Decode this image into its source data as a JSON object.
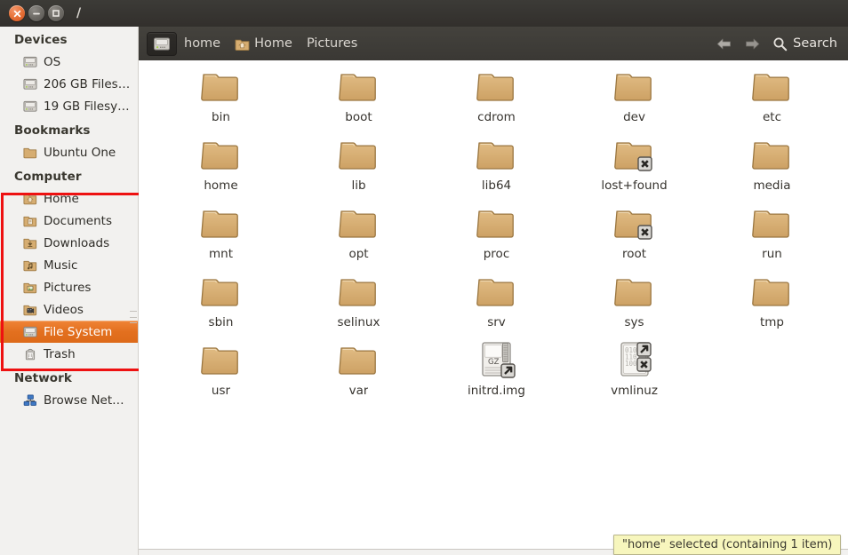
{
  "window": {
    "title": "/",
    "buttons": {
      "close": "close-button",
      "minimize": "minimize-button",
      "maximize": "maximize-button"
    }
  },
  "toolbar": {
    "location_icon": "drive-icon",
    "crumbs": [
      {
        "label": "home",
        "icon": "drive-icon"
      },
      {
        "label": "Home",
        "icon": "home-folder-icon"
      },
      {
        "label": "Pictures",
        "icon": ""
      }
    ],
    "back_label": "Back",
    "forward_label": "Forward",
    "search_label": "Search"
  },
  "sidebar": {
    "sections": [
      {
        "title": "Devices",
        "items": [
          {
            "label": "OS",
            "icon": "drive-icon",
            "selected": false
          },
          {
            "label": "206 GB Files…",
            "icon": "drive-icon",
            "selected": false
          },
          {
            "label": "19 GB Filesy…",
            "icon": "drive-icon",
            "selected": false
          }
        ]
      },
      {
        "title": "Bookmarks",
        "items": [
          {
            "label": "Ubuntu One",
            "icon": "folder-icon",
            "selected": false
          }
        ]
      },
      {
        "title": "Computer",
        "items": [
          {
            "label": "Home",
            "icon": "home-folder-icon",
            "selected": false
          },
          {
            "label": "Documents",
            "icon": "documents-folder-icon",
            "selected": false
          },
          {
            "label": "Downloads",
            "icon": "downloads-folder-icon",
            "selected": false
          },
          {
            "label": "Music",
            "icon": "music-folder-icon",
            "selected": false
          },
          {
            "label": "Pictures",
            "icon": "pictures-folder-icon",
            "selected": false
          },
          {
            "label": "Videos",
            "icon": "videos-folder-icon",
            "selected": false
          },
          {
            "label": "File System",
            "icon": "drive-icon",
            "selected": true
          },
          {
            "label": "Trash",
            "icon": "trash-icon",
            "selected": false
          }
        ]
      },
      {
        "title": "Network",
        "items": [
          {
            "label": "Browse Net…",
            "icon": "network-icon",
            "selected": false
          }
        ]
      }
    ]
  },
  "main": {
    "items": [
      {
        "name": "bin",
        "type": "folder",
        "emblems": []
      },
      {
        "name": "boot",
        "type": "folder",
        "emblems": []
      },
      {
        "name": "cdrom",
        "type": "folder",
        "emblems": []
      },
      {
        "name": "dev",
        "type": "folder",
        "emblems": []
      },
      {
        "name": "etc",
        "type": "folder",
        "emblems": []
      },
      {
        "name": "home",
        "type": "folder",
        "emblems": []
      },
      {
        "name": "lib",
        "type": "folder",
        "emblems": []
      },
      {
        "name": "lib64",
        "type": "folder",
        "emblems": []
      },
      {
        "name": "lost+found",
        "type": "folder",
        "emblems": [
          "noaccess"
        ]
      },
      {
        "name": "media",
        "type": "folder",
        "emblems": []
      },
      {
        "name": "mnt",
        "type": "folder",
        "emblems": []
      },
      {
        "name": "opt",
        "type": "folder",
        "emblems": []
      },
      {
        "name": "proc",
        "type": "folder",
        "emblems": []
      },
      {
        "name": "root",
        "type": "folder",
        "emblems": [
          "noaccess"
        ]
      },
      {
        "name": "run",
        "type": "folder",
        "emblems": []
      },
      {
        "name": "sbin",
        "type": "folder",
        "emblems": []
      },
      {
        "name": "selinux",
        "type": "folder",
        "emblems": []
      },
      {
        "name": "srv",
        "type": "folder",
        "emblems": []
      },
      {
        "name": "sys",
        "type": "folder",
        "emblems": []
      },
      {
        "name": "tmp",
        "type": "folder",
        "emblems": []
      },
      {
        "name": "usr",
        "type": "folder",
        "emblems": []
      },
      {
        "name": "var",
        "type": "folder",
        "emblems": []
      },
      {
        "name": "initrd.img",
        "type": "archive-gz",
        "emblems": [
          "symlink"
        ],
        "badge": "GZ"
      },
      {
        "name": "vmlinuz",
        "type": "binary",
        "emblems": [
          "symlink",
          "noaccess"
        ],
        "binary_text": [
          "010",
          "1101",
          "100"
        ]
      }
    ]
  },
  "status": {
    "text": "\"home\" selected (containing 1 item)"
  },
  "colors": {
    "accent_orange": "#e3701f",
    "titlebar": "#3a3835",
    "toolbar": "#3f3d39",
    "sidebar_bg": "#f2f1ef",
    "folder": "#d5ab6e",
    "annotation_red": "#ee1111",
    "status_bg": "#f7f6bd"
  }
}
